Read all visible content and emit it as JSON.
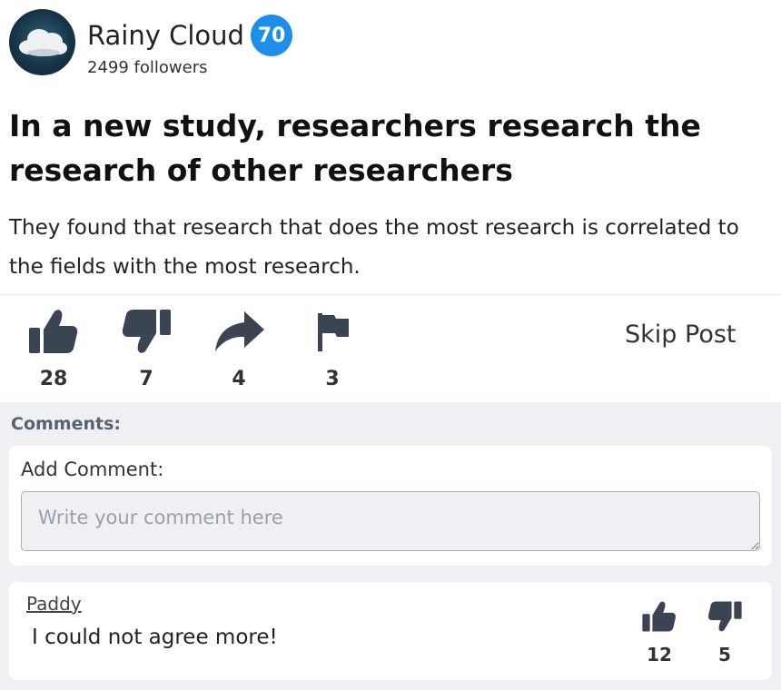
{
  "author": {
    "name": "Rainy Cloud",
    "score": "70",
    "followers": "2499 followers",
    "avatar_icon": "cloud-icon"
  },
  "post": {
    "title": "In a new study, researchers research the research of other researchers",
    "body": "They found that research that does the most research is correlated to the fields with the most research."
  },
  "actions": {
    "like": {
      "icon": "thumbs-up-icon",
      "count": "28"
    },
    "dislike": {
      "icon": "thumbs-down-icon",
      "count": "7"
    },
    "share": {
      "icon": "share-arrow-icon",
      "count": "4"
    },
    "flag": {
      "icon": "flag-icon",
      "count": "3"
    },
    "skip_label": "Skip Post"
  },
  "comments": {
    "label": "Comments:",
    "add_label": "Add Comment:",
    "placeholder": "Write your comment here",
    "items": [
      {
        "user": "Paddy",
        "text": "I could not agree more!",
        "likes": "12",
        "dislikes": "5"
      }
    ]
  },
  "colors": {
    "badge": "#1d8fe8",
    "icon": "#3b4452",
    "comments_bg": "#eef0f4"
  }
}
